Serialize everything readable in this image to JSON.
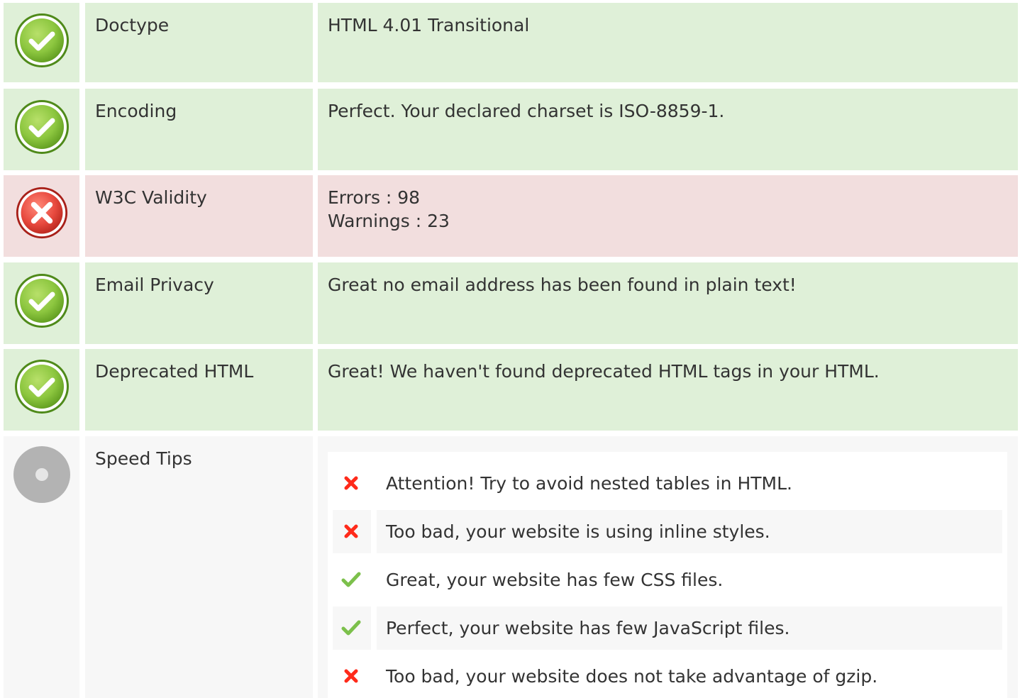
{
  "checks": [
    {
      "status": "pass",
      "label": "Doctype",
      "value_lines": [
        "HTML 4.01 Transitional"
      ]
    },
    {
      "status": "pass",
      "label": "Encoding",
      "value_lines": [
        "Perfect. Your declared charset is ISO-8859-1."
      ]
    },
    {
      "status": "fail",
      "label": "W3C Validity",
      "value_lines": [
        "Errors : 98",
        "Warnings : 23"
      ]
    },
    {
      "status": "pass",
      "label": "Email Privacy",
      "value_lines": [
        "Great no email address has been found in plain text!"
      ]
    },
    {
      "status": "pass",
      "label": "Deprecated HTML",
      "value_lines": [
        "Great! We haven't found deprecated HTML tags in your HTML."
      ]
    }
  ],
  "speed_tips": {
    "label": "Speed Tips",
    "icon": "neutral-circle-icon",
    "tips": [
      {
        "status": "bad",
        "icon": "cross-icon",
        "text": "Attention! Try to avoid nested tables in HTML."
      },
      {
        "status": "bad",
        "icon": "cross-icon",
        "text": "Too bad, your website is using inline styles."
      },
      {
        "status": "good",
        "icon": "check-icon",
        "text": "Great, your website has few CSS files."
      },
      {
        "status": "good",
        "icon": "check-icon",
        "text": "Perfect, your website has few JavaScript files."
      },
      {
        "status": "bad",
        "icon": "cross-icon",
        "text": "Too bad, your website does not take advantage of gzip."
      }
    ]
  },
  "colors": {
    "pass_row": "#dff0d8",
    "fail_row": "#f2dede",
    "neutral_row": "#f7f7f7",
    "pass_icon": "#8cc63f",
    "fail_icon": "#e84a3f",
    "neutral_icon": "#b3b3b3",
    "tip_cross": "#ff2a1a",
    "tip_check": "#7cc04b"
  }
}
